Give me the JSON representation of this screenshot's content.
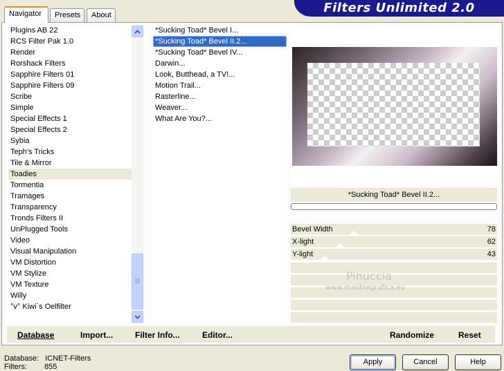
{
  "tabs": [
    {
      "label": "Navigator"
    },
    {
      "label": "Presets"
    },
    {
      "label": "About"
    }
  ],
  "logo": {
    "text": "Filters Unlimited 2.0"
  },
  "categories": [
    "Plugins AB 22",
    "RCS Filter Pak 1.0",
    "Render",
    "Rorshack Filters",
    "Sapphire Filters 01",
    "Sapphire Filters 09",
    "Scribe",
    "Simple",
    "Special Effects 1",
    "Special Effects 2",
    "Sybia",
    "Teph's Tricks",
    "Tile & Mirror",
    "Toadies",
    "Tormentia",
    "Tramages",
    "Transparency",
    "Tronds Filters II",
    "UnPlugged Tools",
    "Video",
    "Visual Manipulation",
    "VM Distortion",
    "VM Stylize",
    "VM Texture",
    "Willy",
    "°v° Kiwi`s Oelfilter"
  ],
  "selected_category": "Toadies",
  "filters": [
    "*Sucking Toad*  Bevel I...",
    "*Sucking Toad*  Bevel II.2...",
    "*Sucking Toad*  Bevel IV...",
    "Darwin...",
    "Look, Butthead, a TV!...",
    "Motion Trail...",
    "Rasterline...",
    "Weaver...",
    "What Are You?..."
  ],
  "selected_filter": "*Sucking Toad*  Bevel II.2...",
  "preview": {
    "filter_name": "*Sucking Toad*  Bevel II.2..."
  },
  "sliders": [
    {
      "label": "Bevel Width",
      "value": 78
    },
    {
      "label": "X-light",
      "value": 62
    },
    {
      "label": "Y-light",
      "value": 43
    }
  ],
  "watermark": {
    "name": "Pinuccia",
    "url": "www.maidiregrafica.eu"
  },
  "bottom_buttons": {
    "database": "Database",
    "import": "Import...",
    "filter_info": "Filter Info...",
    "editor": "Editor...",
    "randomize": "Randomize",
    "reset": "Reset"
  },
  "status": {
    "database_label": "Database:",
    "database_value": "ICNET-Filters",
    "filters_label": "Filters:",
    "filters_value": "855"
  },
  "dialog_buttons": {
    "apply": "Apply",
    "cancel": "Cancel",
    "help": "Help"
  },
  "colors": {
    "selection": "#316ac5",
    "logo_bg": "#1a1a8c",
    "dialog_bg": "#ece9d8"
  }
}
